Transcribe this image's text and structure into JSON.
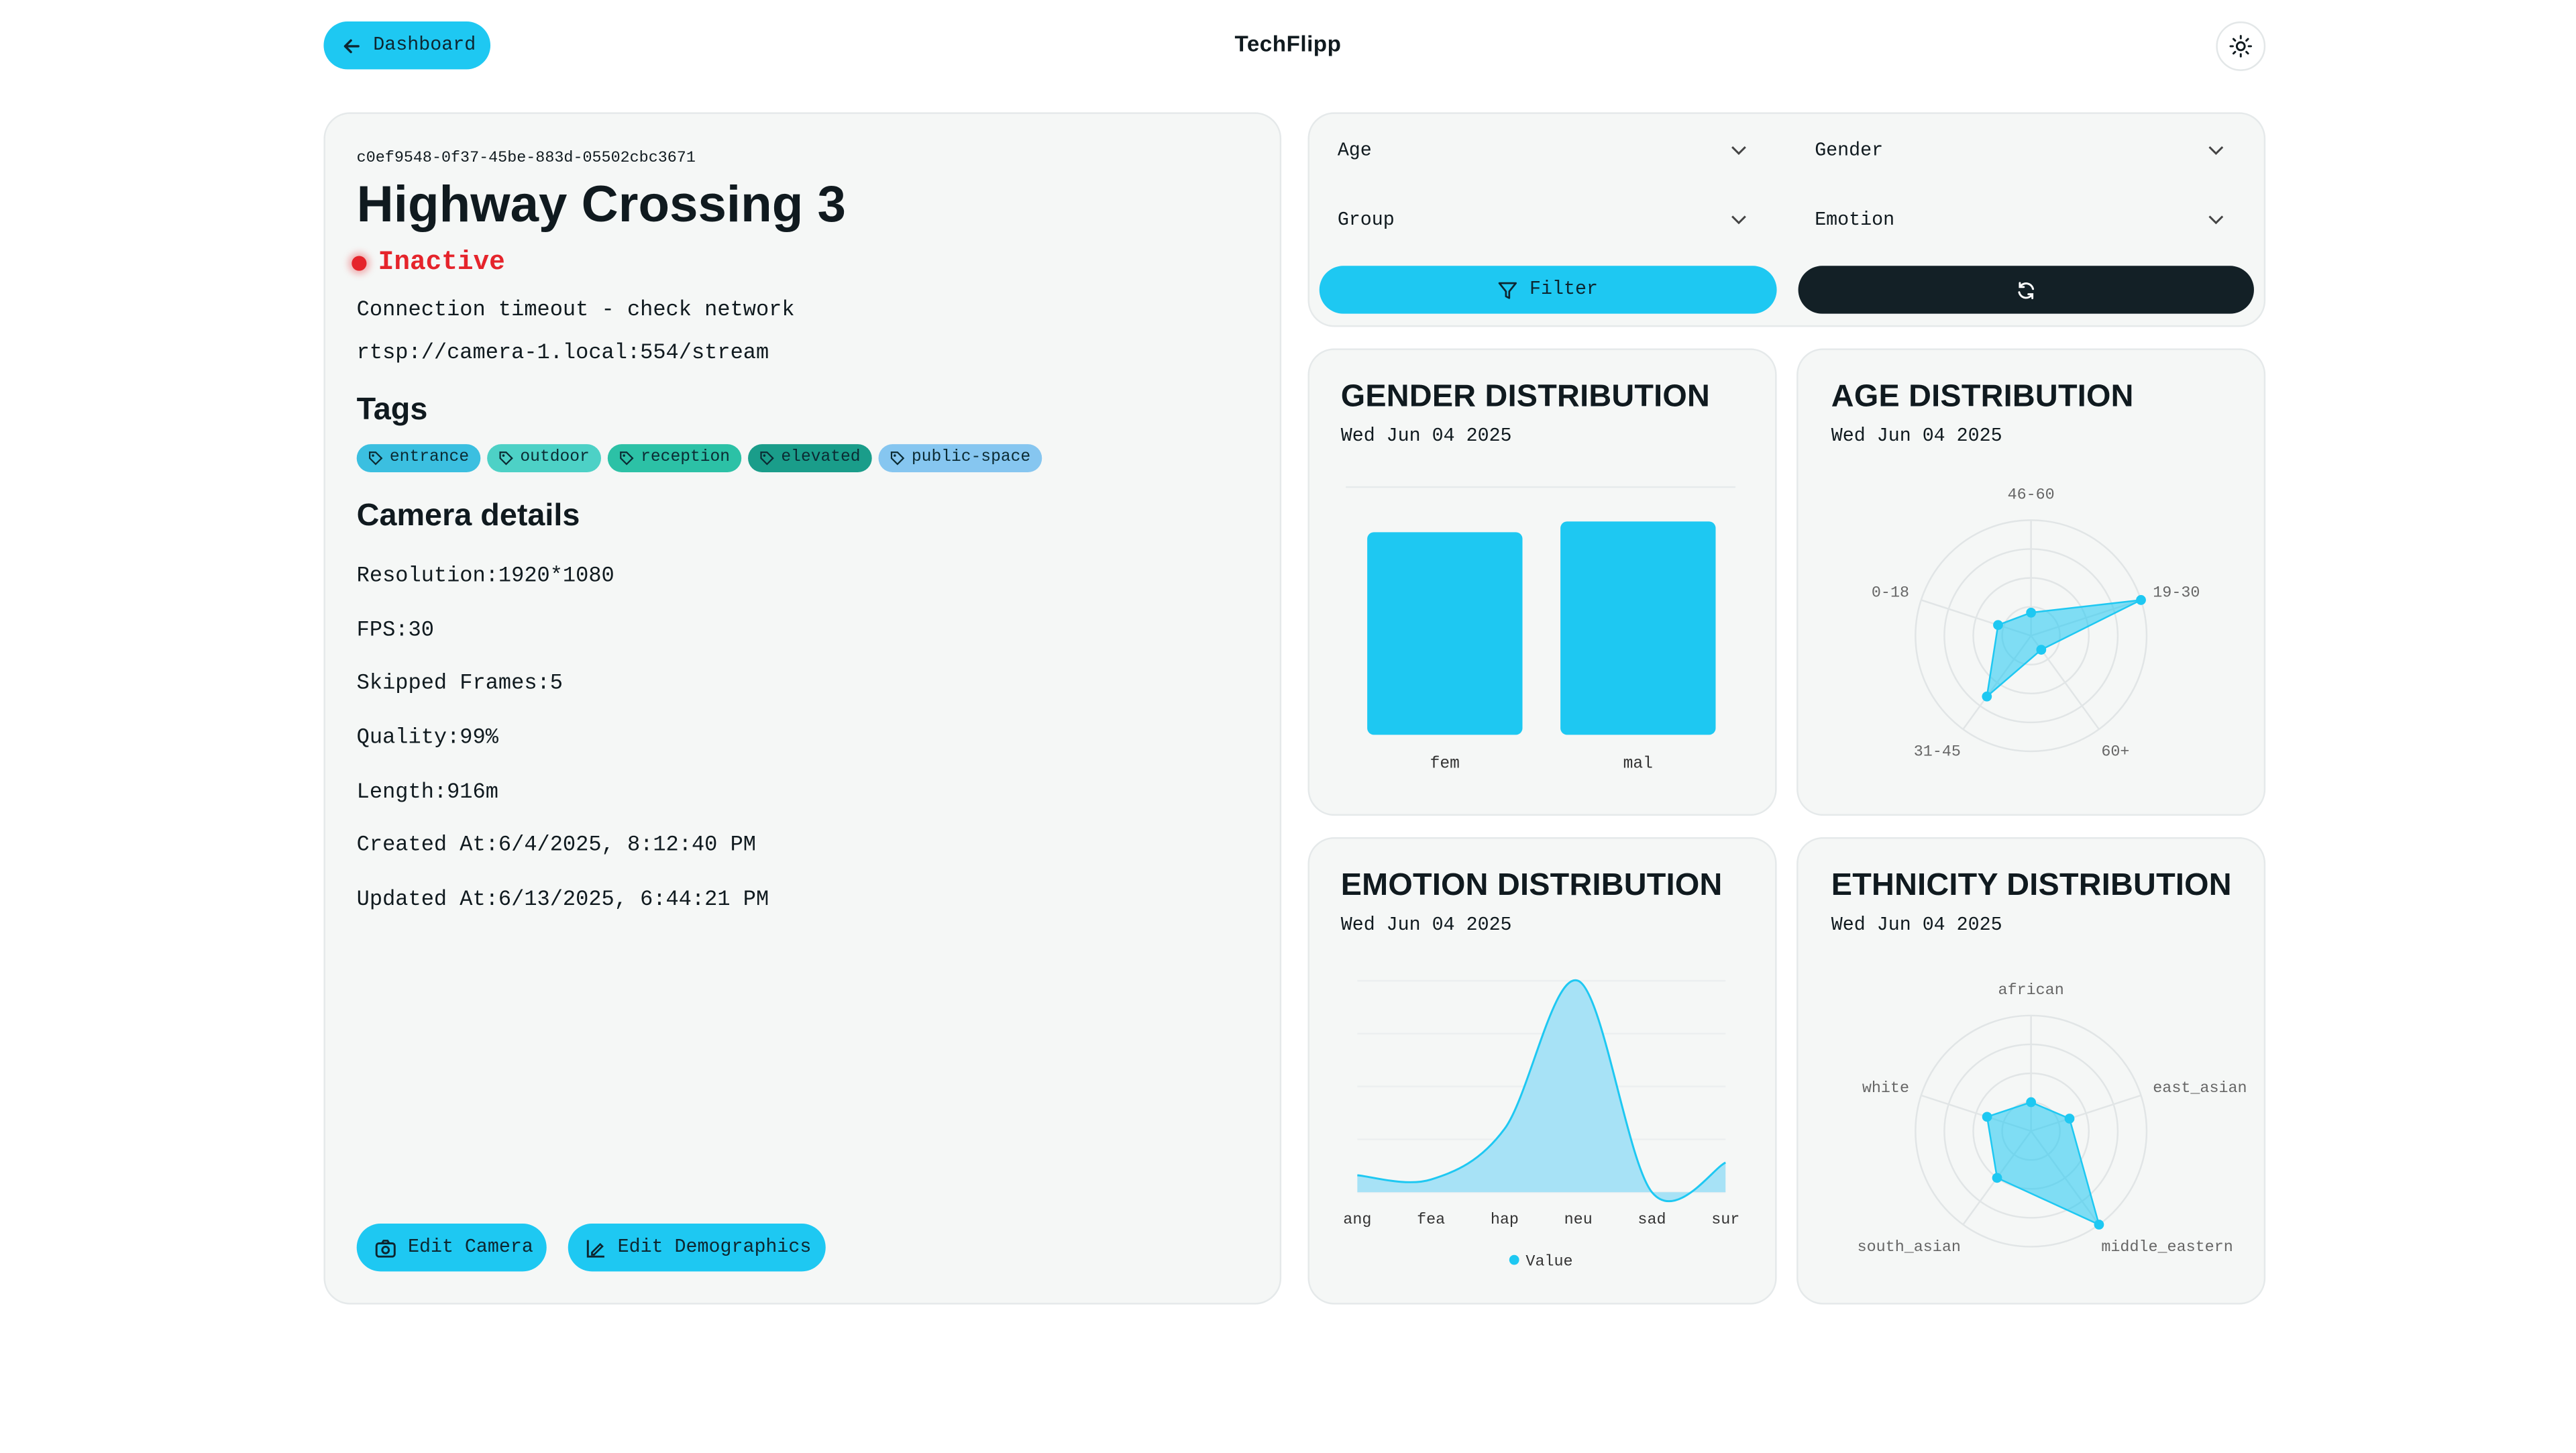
{
  "header": {
    "back_label": "Dashboard",
    "brand": "TechFlipp",
    "theme_icon": "sun-icon"
  },
  "camera": {
    "id": "c0ef9548-0f37-45be-883d-05502cbc3671",
    "name": "Highway Crossing 3",
    "status": "Inactive",
    "status_color": "#e5242b",
    "message": "Connection timeout - check network",
    "stream_url": "rtsp://camera-1.local:554/stream",
    "tags_heading": "Tags",
    "tags": [
      {
        "label": "entrance",
        "color": "#3bbfe0"
      },
      {
        "label": "outdoor",
        "color": "#4dd1c6"
      },
      {
        "label": "reception",
        "color": "#2cc1a6"
      },
      {
        "label": "elevated",
        "color": "#1a9d8a"
      },
      {
        "label": "public-space",
        "color": "#86c6f0"
      }
    ],
    "details_heading": "Camera details",
    "details": [
      "Resolution:1920*1080",
      "FPS:30",
      "Skipped Frames:5",
      "Quality:99%",
      "Length:916m",
      "Created At:6/4/2025, 8:12:40 PM",
      "Updated At:6/13/2025, 6:44:21 PM"
    ],
    "edit_camera_label": "Edit Camera",
    "edit_demographics_label": "Edit Demographics"
  },
  "filters": {
    "age": "Age",
    "gender": "Gender",
    "group": "Group",
    "emotion": "Emotion",
    "filter_label": "Filter"
  },
  "colors": {
    "accent": "#1ec8f2",
    "dark": "#132026",
    "area_fill": "#a7e2f6"
  },
  "chart_data": [
    {
      "type": "bar",
      "title": "GENDER DISTRIBUTION",
      "subtitle": "Wed Jun 04 2025",
      "categories": [
        "fem",
        "mal"
      ],
      "values": [
        0.95,
        1.0
      ],
      "ylim": [
        0,
        1.2
      ]
    },
    {
      "type": "radar",
      "title": "AGE DISTRIBUTION",
      "subtitle": "Wed Jun 04 2025",
      "categories": [
        "46-60",
        "19-30",
        "60+",
        "31-45",
        "0-18"
      ],
      "values": [
        0.2,
        1.0,
        0.15,
        0.65,
        0.3
      ]
    },
    {
      "type": "area",
      "title": "EMOTION DISTRIBUTION",
      "subtitle": "Wed Jun 04 2025",
      "categories": [
        "ang",
        "fea",
        "hap",
        "neu",
        "sad",
        "sur"
      ],
      "series": [
        {
          "name": "Value",
          "values": [
            8,
            6,
            30,
            100,
            0,
            14
          ]
        }
      ],
      "legend": "bottom"
    },
    {
      "type": "radar",
      "title": "ETHNICITY DISTRIBUTION",
      "subtitle": "Wed Jun 04 2025",
      "categories": [
        "african",
        "east_asian",
        "middle_eastern",
        "south_asian",
        "white"
      ],
      "values": [
        0.25,
        0.35,
        1.0,
        0.5,
        0.4
      ]
    }
  ]
}
